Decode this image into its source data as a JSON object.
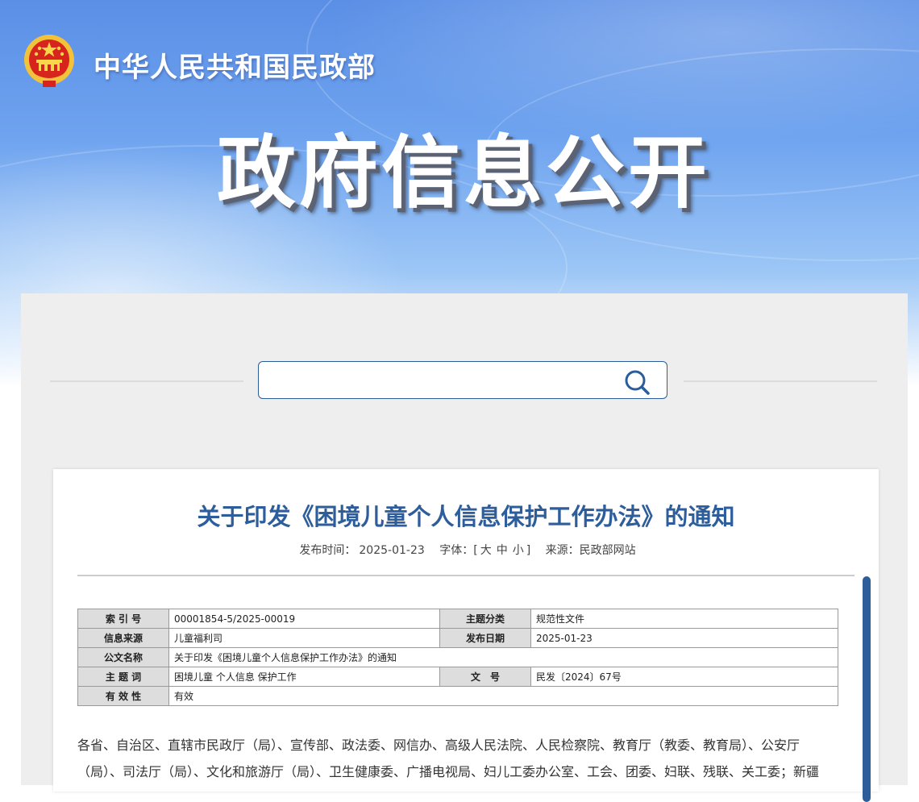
{
  "header": {
    "ministry_name": "中华人民共和国民政部",
    "main_title": "政府信息公开",
    "emblem_icon": "national-emblem-icon"
  },
  "search": {
    "value": "",
    "icon": "search-icon",
    "border_color": "#2b5d9a"
  },
  "article": {
    "title": "关于印发《困境儿童个人信息保护工作办法》的通知",
    "meta": {
      "publish_label": "发布时间：",
      "publish_date": "2025-01-23",
      "font_label": "字体：",
      "font_open": "[",
      "font_large": "大",
      "font_medium": "中",
      "font_small": "小",
      "font_close": "]",
      "source_label": "来源：",
      "source_value": "民政部网站"
    },
    "info_table": {
      "index_label": "索 引 号",
      "index_value": "00001854-5/2025-00019",
      "topic_label": "主题分类",
      "topic_value": "规范性文件",
      "origin_label": "信息来源",
      "origin_value": "儿童福利司",
      "date_label": "发布日期",
      "date_value": "2025-01-23",
      "doc_name_label": "公文名称",
      "doc_name_value": "关于印发《困境儿童个人信息保护工作办法》的通知",
      "keywords_label": "主 题 词",
      "keywords_value": "困境儿童 个人信息 保护工作",
      "doc_no_label": "文　号",
      "doc_no_value": "民发〔2024〕67号",
      "validity_label": "有 效 性",
      "validity_value": "有效"
    },
    "body_line1": "各省、自治区、直辖市民政厅（局）、宣传部、政法委、网信办、高级人民法院、人民检察院、教育厅（教委、教育局）、公安厅",
    "body_line2": "（局）、司法厅（局）、文化和旅游厅（局）、卫生健康委、广播电视局、妇儿工委办公室、工会、团委、妇联、残联、关工委；新疆"
  },
  "colors": {
    "accent": "#2d5d9b",
    "panel_bg": "#eeeeee",
    "table_label_bg": "#dddddd"
  }
}
